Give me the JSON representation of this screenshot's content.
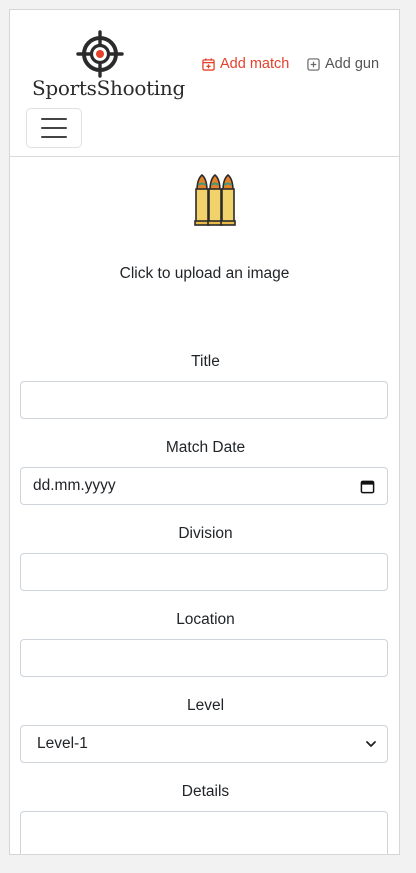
{
  "header": {
    "logo_text": "SportsShooting",
    "nav": {
      "add_match": "Add match",
      "add_gun": "Add gun"
    },
    "toggle_label": "Toggle navigation"
  },
  "colors": {
    "accent": "#e4412b",
    "muted": "#555555",
    "border": "#ced4da"
  },
  "upload": {
    "text": "Click to upload an image",
    "icon": "bullets-icon"
  },
  "form": {
    "title_label": "Title",
    "title_value": "",
    "date_label": "Match Date",
    "date_placeholder": "dd.mm.yyyy",
    "division_label": "Division",
    "division_value": "",
    "location_label": "Location",
    "location_value": "",
    "level_label": "Level",
    "level_selected": "Level-1",
    "details_label": "Details",
    "details_value": ""
  }
}
